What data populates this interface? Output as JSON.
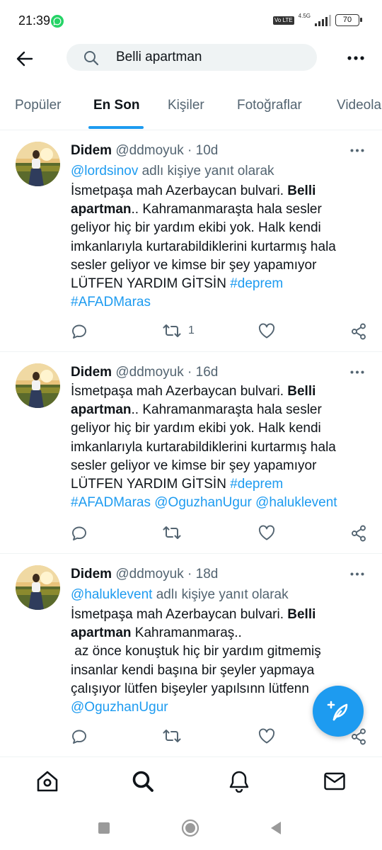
{
  "status_bar": {
    "time": "21:39",
    "network": "4.5G",
    "volte": "Vo LTE",
    "battery": "70",
    "app_notification_icon": "whatsapp-icon"
  },
  "search": {
    "query": "Belli apartman",
    "placeholder": "Belli apartman"
  },
  "tabs": [
    {
      "label": "Popüler"
    },
    {
      "label": "En Son",
      "active": true
    },
    {
      "label": "Kişiler"
    },
    {
      "label": "Fotoğraflar"
    },
    {
      "label": "Videolar"
    }
  ],
  "tweets": [
    {
      "name": "Didem",
      "handle": "@ddmoyuk",
      "time": "· 10d",
      "reply_to": "@lordsinov",
      "reply_suffix": " adlı kişiye yanıt olarak",
      "text_1": "İsmetpaşa mah Azerbaycan bulvari. ",
      "bold": "Belli apartman",
      "text_2": ".. Kahramanmaraşta hala sesler geliyor hiç bir yardım ekibi yok. Halk kendi imkanlarıyla kurtarabildiklerini kurtarmış hala sesler geliyor ve kimse bir şey yapamıyor LÜTFEN YARDIM GİTSİN ",
      "hashtag_1": "#deprem",
      "hashtag_2": "#AFADMaras",
      "retweets": "1"
    },
    {
      "name": "Didem",
      "handle": "@ddmoyuk",
      "time": "· 16d",
      "text_1": "İsmetpaşa mah Azerbaycan bulvari. ",
      "bold": "Belli apartman",
      "text_2": ".. Kahramanmaraşta hala sesler geliyor hiç bir yardım ekibi yok. Halk kendi imkanlarıyla kurtarabildiklerini kurtarmış hala sesler geliyor ve kimse bir şey yapamıyor LÜTFEN YARDIM GİTSİN ",
      "hashtag_1": "#deprem",
      "hashtag_2": "#AFADMaras",
      "mention_1": "@OguzhanUgur",
      "mention_2": "@haluklevent"
    },
    {
      "name": "Didem",
      "handle": "@ddmoyuk",
      "time": "· 18d",
      "reply_to": "@haluklevent",
      "reply_suffix": " adlı kişiye yanıt olarak",
      "text_1": "İsmetpaşa mah Azerbaycan bulvari. ",
      "bold": "Belli apartman",
      "text_2": " Kahramanmaraş..",
      "text_3": "az önce konuştuk hiç bir yardım gitmemiş insanlar kendi başına bir şeyler yapmaya çalışıyor lütfen bişeyler yapılsınn lütfenn",
      "mention_1": "@OguzhanUgur"
    }
  ],
  "bottom_nav": [
    "home-icon",
    "search-icon",
    "bell-icon",
    "mail-icon"
  ],
  "colors": {
    "accent": "#1d9bf0",
    "text": "#0f1419",
    "secondary": "#536471"
  }
}
